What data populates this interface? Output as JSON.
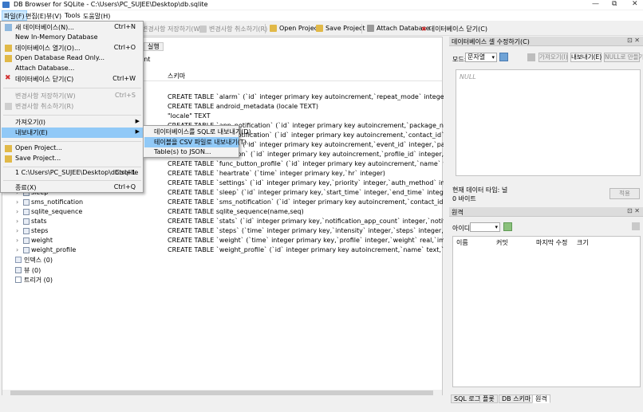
{
  "window": {
    "title": "DB Browser for SQLite - C:\\Users\\PC_SUJEE\\Desktop\\db.sqlite",
    "minimize": "—",
    "restore": "⧉",
    "close": "✕"
  },
  "menubar": {
    "items": [
      "파일(F)",
      "편집(E)",
      "뷰(V)",
      "Tools",
      "도움말(H)"
    ]
  },
  "toolbar": {
    "write_changes": "변경사항 저장하기(W)",
    "revert_changes": "변경사항 취소하기(R)",
    "open_project": "Open Project",
    "save_project": "Save Project",
    "attach_database": "Attach Database",
    "close_database": "데이터베이스 닫기(C)"
  },
  "tabs": {
    "execute": "실행",
    "print_partial": "int"
  },
  "table_header": {
    "schema": "스키마"
  },
  "file_menu": {
    "new_db": {
      "label": "새 데이터베이스(N)...",
      "shortcut": "Ctrl+N"
    },
    "new_memory": {
      "label": "New In-Memory Database"
    },
    "open_db": {
      "label": "데이터베이스 열기(O)...",
      "shortcut": "Ctrl+O"
    },
    "open_readonly": {
      "label": "Open Database Read Only..."
    },
    "attach": {
      "label": "Attach Database..."
    },
    "close_db": {
      "label": "데이터베이스 닫기(C)",
      "shortcut": "Ctrl+W"
    },
    "write_changes": {
      "label": "변경사항 저장하기(W)",
      "shortcut": "Ctrl+S"
    },
    "revert_changes": {
      "label": "변경사항 취소하기(R)"
    },
    "import": {
      "label": "가져오기(I)"
    },
    "export": {
      "label": "내보내기(E)"
    },
    "open_project": {
      "label": "Open Project..."
    },
    "save_project": {
      "label": "Save Project..."
    },
    "recent": {
      "label": "1 C:\\Users\\PC_SUJEE\\Desktop\\db.sqlite",
      "shortcut": "Ctrl+1"
    },
    "exit": {
      "label": "종료(X)",
      "shortcut": "Ctrl+Q"
    }
  },
  "export_submenu": {
    "items": [
      "데이터베이스를 SQL로 내보내기(D)...",
      "테이블을 CSV 파일로 내보내기(T)...",
      "Table(s) to JSON..."
    ]
  },
  "schema_rows": [
    {
      "name": "",
      "schema": "CREATE TABLE `alarm` (`id` integer primary key autoincrement,`repeat_mode` integer,`label` text,`timer_id` integer,`alarm_index` i"
    },
    {
      "name": "",
      "schema": "CREATE TABLE android_metadata (locale TEXT)"
    },
    {
      "name": "",
      "schema": "\"locale\" TEXT"
    },
    {
      "name": "",
      "schema": "CREATE TABLE `app_notification` (`id` integer primary key autoincrement,`package_name` text,`notification_icon` integer,`notificati"
    },
    {
      "name": "",
      "schema": "CREATE TABLE `call_notification` (`id` integer primary key autoincrement,`contact_id` text,`notification_icon` integer,`notificatio"
    },
    {
      "name": "",
      "schema": "CREATE TABLE `event` (`id` integer primary key autoincrement,`event_id` integer,`param_n` integer,`notification_icon` integer,`notificati"
    },
    {
      "name": "",
      "schema": "CREATE TABLE `function` (`id` integer primary key autoincrement,`profile_id` integer,`tap_count` integer,`action` integ"
    },
    {
      "name": "",
      "schema": "CREATE TABLE `func_button_profile` (`id` integer primary key autoincrement,`name` text,`player_package` text,`time_interval` inte"
    },
    {
      "name": "",
      "schema": "CREATE TABLE `heartrate` (`time` integer primary key,`hr` integer)"
    },
    {
      "name": "",
      "schema": "CREATE TABLE `settings` (`id` integer primary key,`priority` integer,`auth_method` integer,`is_paired` integer,`miband_version` inte"
    },
    {
      "name": "sleep",
      "schema": "CREATE TABLE `sleep` (`id` integer primary key,`start_time` integer,`end_time` integer,`awake` integer,`deep` integer,`light` integer"
    },
    {
      "name": "sms_notification",
      "schema": "CREATE TABLE `sms_notification` (`id` integer primary key autoincrement,`contact_id` text,`notification_icon` integer,`notificatio"
    },
    {
      "name": "sqlite_sequence",
      "schema": "CREATE TABLE sqlite_sequence(name,seq)"
    },
    {
      "name": "stats",
      "schema": "CREATE TABLE `stats` (`id` integer primary key,`notification_app_count` integer,`notification_call_count` integer,`notification_sms_"
    },
    {
      "name": "steps",
      "schema": "CREATE TABLE `steps` (`time` integer primary key,`intensity` integer,`steps` integer,`category` integer)"
    },
    {
      "name": "weight",
      "schema": "CREATE TABLE `weight` (`time` integer primary key,`profile` integer,`weight` real,`impedance` integer,`moisture` real,`moisture_p"
    },
    {
      "name": "weight_profile",
      "schema": "CREATE TABLE `weight_profile` (`id` integer primary key autoincrement,`name` text,`gender` integer,`height` integer,`day` integer"
    }
  ],
  "tree_footer": {
    "indexes": "인덱스 (0)",
    "views": "뷰 (0)",
    "triggers": "트리거 (0)"
  },
  "edit_cell": {
    "title": "데이터베이스 셀 수정하기(C)",
    "mode_label": "모드:",
    "mode_value": "문자열",
    "import": "가져오기(I)",
    "export": "내보내기(E)",
    "set_null": "NULL로 만들기",
    "placeholder": "NULL",
    "data_type": "현재 데이터 타입: 널",
    "size": "0 바이트",
    "apply": "적용"
  },
  "remote": {
    "title": "원격",
    "identity_label": "아이디",
    "columns": [
      "이름",
      "커밋",
      "마지막 수정",
      "크기"
    ]
  },
  "bottom_tabs": [
    "SQL 로그",
    "플롯",
    "DB 스키마",
    "원격"
  ],
  "panel_controls": "⊡ ✕"
}
